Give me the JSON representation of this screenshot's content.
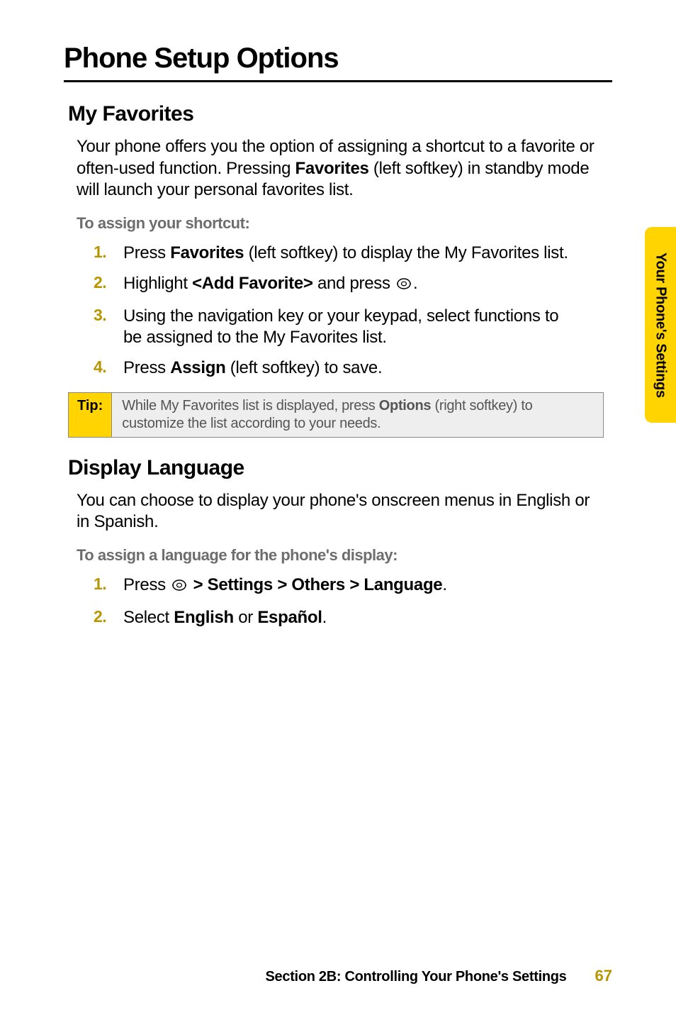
{
  "heading_main": "Phone Setup Options",
  "section1": {
    "heading": "My Favorites",
    "intro_pre": "Your phone offers you the option of assigning a shortcut to a favorite or often-used function. Pressing ",
    "intro_bold": "Favorites",
    "intro_post": " (left softkey) in standby mode will launch your personal favorites list.",
    "instr_heading": "To assign your shortcut:",
    "steps": [
      {
        "num": "1.",
        "pre": "Press ",
        "b1": "Favorites",
        "post": " (left softkey) to display the My Favorites list."
      },
      {
        "num": "2.",
        "pre": "Highlight ",
        "b1": "<Add Favorite>",
        "mid": " and press ",
        "icon": true,
        "post": "."
      },
      {
        "num": "3.",
        "text": "Using the navigation key or your keypad, select functions to be assigned to the My Favorites list."
      },
      {
        "num": "4.",
        "pre": "Press ",
        "b1": "Assign",
        "post": " (left softkey) to save."
      }
    ],
    "tip": {
      "label": "Tip:",
      "pre": "While My Favorites list is displayed, press ",
      "bold": "Options",
      "post": " (right softkey) to customize the list according to your needs."
    }
  },
  "section2": {
    "heading": "Display Language",
    "intro": "You can choose to display your phone's onscreen menus in English or in Spanish.",
    "instr_heading": "To assign a language for the phone's display:",
    "steps": [
      {
        "num": "1.",
        "pre": "Press ",
        "icon": true,
        "post_bold": " > Settings > Others > Language",
        "post": "."
      },
      {
        "num": "2.",
        "pre": "Select ",
        "b1": "English",
        "mid": " or ",
        "b2": "Español",
        "post": "."
      }
    ]
  },
  "side_tab": "Your Phone's Settings",
  "footer": {
    "section": "Section 2B: Controlling Your Phone's Settings",
    "page": "67"
  }
}
